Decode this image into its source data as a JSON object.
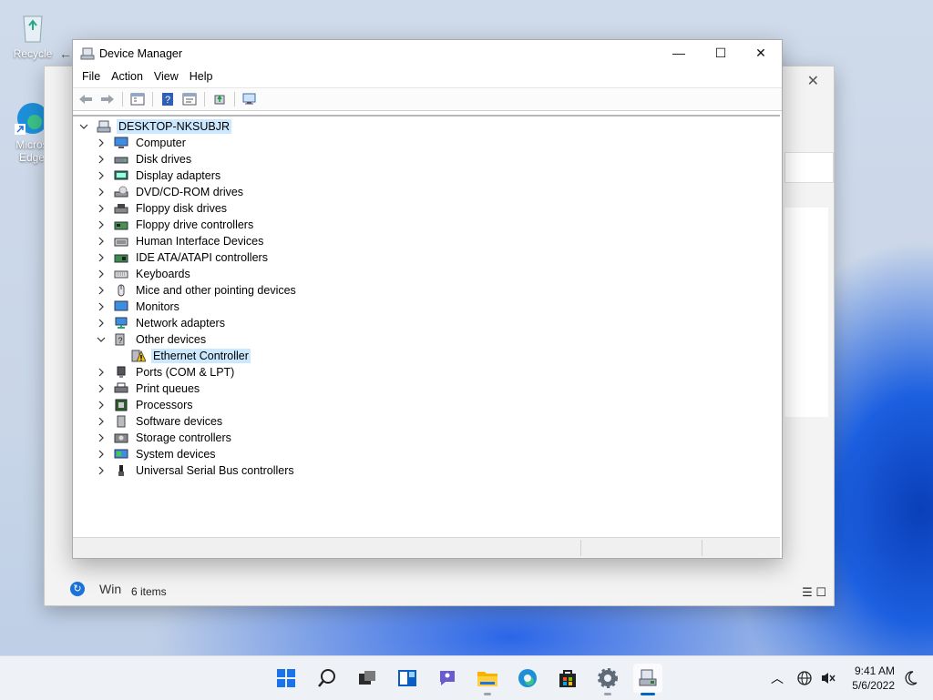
{
  "desktop": {
    "icons": [
      {
        "label": "Recycle"
      },
      {
        "label": "Micros Edge"
      }
    ]
  },
  "background_window": {
    "status_items": "6 items",
    "footer_label": "Win"
  },
  "device_manager": {
    "title": "Device Manager",
    "controls": {
      "minimize": "—",
      "maximize": "☐",
      "close": "✕"
    },
    "menu": [
      "File",
      "Action",
      "View",
      "Help"
    ],
    "root": "DESKTOP-NKSUBJR",
    "categories": [
      {
        "label": "Computer",
        "icon": "computer-icon"
      },
      {
        "label": "Disk drives",
        "icon": "disk-drive-icon"
      },
      {
        "label": "Display adapters",
        "icon": "display-adapter-icon"
      },
      {
        "label": "DVD/CD-ROM drives",
        "icon": "dvd-drive-icon"
      },
      {
        "label": "Floppy disk drives",
        "icon": "floppy-disk-icon"
      },
      {
        "label": "Floppy drive controllers",
        "icon": "floppy-controller-icon"
      },
      {
        "label": "Human Interface Devices",
        "icon": "hid-icon"
      },
      {
        "label": "IDE ATA/ATAPI controllers",
        "icon": "ide-controller-icon"
      },
      {
        "label": "Keyboards",
        "icon": "keyboard-icon"
      },
      {
        "label": "Mice and other pointing devices",
        "icon": "mouse-icon"
      },
      {
        "label": "Monitors",
        "icon": "monitor-icon"
      },
      {
        "label": "Network adapters",
        "icon": "network-adapter-icon"
      },
      {
        "label": "Other devices",
        "icon": "other-devices-icon",
        "expanded": true
      },
      {
        "label": "Ethernet Controller",
        "icon": "warning-device-icon",
        "child": true,
        "selected": true
      },
      {
        "label": "Ports (COM & LPT)",
        "icon": "port-icon"
      },
      {
        "label": "Print queues",
        "icon": "printer-icon"
      },
      {
        "label": "Processors",
        "icon": "processor-icon"
      },
      {
        "label": "Software devices",
        "icon": "software-device-icon"
      },
      {
        "label": "Storage controllers",
        "icon": "storage-controller-icon"
      },
      {
        "label": "System devices",
        "icon": "system-devices-icon"
      },
      {
        "label": "Universal Serial Bus controllers",
        "icon": "usb-icon"
      }
    ]
  },
  "taskbar": {
    "apps": [
      "start-icon",
      "search-icon",
      "task-view-icon",
      "widgets-icon",
      "chat-icon",
      "file-explorer-icon",
      "edge-icon",
      "store-icon",
      "settings-icon",
      "device-manager-icon"
    ],
    "time": "9:41 AM",
    "date": "5/6/2022"
  }
}
